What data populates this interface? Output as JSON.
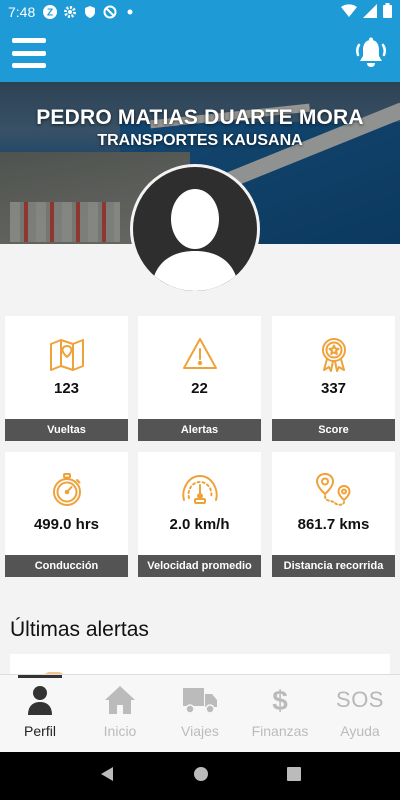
{
  "status_bar": {
    "time": "7:48",
    "icons": [
      "z-app-icon",
      "gear-icon",
      "shield-icon",
      "no-sync-icon",
      "dot-icon",
      "wifi-icon",
      "signal-icon",
      "battery-icon"
    ]
  },
  "app_bar": {
    "menu_icon": "hamburger-menu-icon",
    "notification_icon": "bell-icon"
  },
  "header": {
    "driver_name": "PEDRO MATIAS DUARTE MORA",
    "company": "TRANSPORTES KAUSANA"
  },
  "stats": [
    {
      "icon": "map-icon",
      "value": "123",
      "label": "Vueltas"
    },
    {
      "icon": "warning-icon",
      "value": "22",
      "label": "Alertas"
    },
    {
      "icon": "badge-star-icon",
      "value": "337",
      "label": "Score"
    },
    {
      "icon": "stopwatch-icon",
      "value": "499.0 hrs",
      "label": "Conducción"
    },
    {
      "icon": "speedometer-icon",
      "value": "2.0 km/h",
      "label": "Velocidad promedio"
    },
    {
      "icon": "route-pin-icon",
      "value": "861.7 kms",
      "label": "Distancia recorrida"
    }
  ],
  "alerts_section": {
    "title": "Últimas alertas"
  },
  "bottom_nav": [
    {
      "icon": "person-icon",
      "label": "Perfil",
      "active": true
    },
    {
      "icon": "home-icon",
      "label": "Inicio",
      "active": false
    },
    {
      "icon": "truck-icon",
      "label": "Viajes",
      "active": false
    },
    {
      "icon": "dollar-icon",
      "label": "Finanzas",
      "active": false
    },
    {
      "icon": "sos-icon",
      "label": "Ayuda",
      "active": false,
      "icon_text": "SOS"
    }
  ],
  "colors": {
    "primary": "#1e9bd7",
    "icon_orange": "#f0a23a",
    "label_bar": "#545454",
    "nav_inactive": "#bbbbbb"
  }
}
